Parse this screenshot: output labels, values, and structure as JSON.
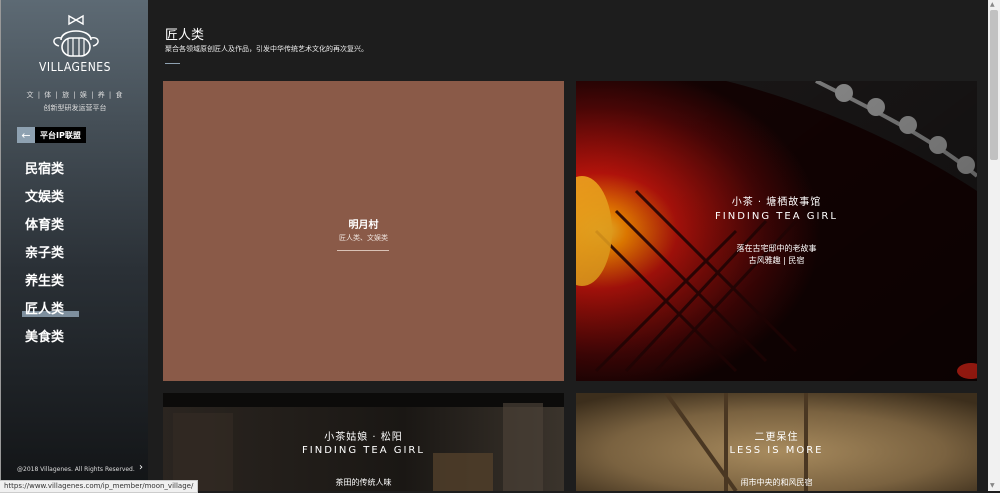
{
  "sidebar": {
    "brand": "VILLAGENES",
    "tagline1": "文 | 体 | 旅 | 娱 | 养 | 食",
    "tagline2": "创新型研发运营平台",
    "ip_alliance_arrow": "←",
    "ip_alliance_label": "平台IP联盟",
    "nav": [
      "民宿类",
      "文娱类",
      "体育类",
      "亲子类",
      "养生类",
      "匠人类",
      "美食类"
    ],
    "active_nav": "匠人类",
    "copyright": "@2018 Villagenes. All Rights Reserved.",
    "expand_arrow": "›",
    "logo_icon": "girl-face-logo"
  },
  "main": {
    "title": "匠人类",
    "description": "聚合各领域原创匠人及作品，引发中华传统艺术文化的再次复兴。",
    "accent": "#8ea1b1",
    "cards": [
      {
        "title": "明月村",
        "subtitle": "匠人类、文娱类"
      },
      {
        "title_cn": "小茶 · 塘栖故事馆",
        "title_en": "FINDING TEA GIRL",
        "line1": "落在古宅邸中的老故事",
        "line2": "古风雅趣 | 民宿"
      },
      {
        "title_cn": "小茶姑娘 · 松阳",
        "title_en": "FINDING TEA GIRL",
        "line1": "茶田的传统人味"
      },
      {
        "title_cn": "二更呆住",
        "title_en": "LESS IS MORE",
        "line1": "闹市中央的和风民宿"
      }
    ]
  },
  "status_bar": {
    "url": "https://www.villagenes.com/ip_member/moon_village/"
  }
}
